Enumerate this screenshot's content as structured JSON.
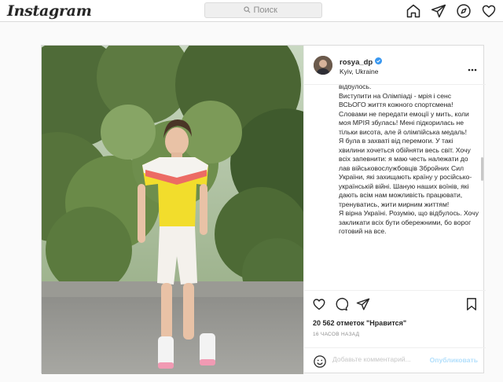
{
  "topbar": {
    "logo": "Instagram",
    "search_placeholder": "Поиск"
  },
  "post": {
    "username": "rosya_dp",
    "location": "Kyiv, Ukraine",
    "caption": "відбулось.\nВиступити на Олімпіаді - мрія і сенс ВСЬОГО життя кожного спортсмена! Словами не передати емоції у мить, коли моя МРІЯ збулась! Мені підкорилась не тільки висота, але й олімпійська медаль!\nЯ була в захваті від перемоги. У такі хвилини хочеться обійняти весь світ. Хочу всіх запевнити: я маю честь належати до лав військовослужбовців Збройних Сил України, які захищають країну у російсько-українській війні. Шаную наших воїнів, які дають всім нам можливість працювати, тренуватись, жити мирним життям!\nЯ вірна Україні. Розумію, що відбулось. Хочу закликати всіх бути обережними, бо ворог готовий на все.",
    "likes": "20 562 отметок \"Нравится\"",
    "time": "16 ЧАСОВ НАЗАД",
    "comment_placeholder": "Добавьте комментарий...",
    "post_button": "Опубликовать"
  },
  "icons": {
    "home": "home-icon",
    "direct": "direct-icon",
    "explore": "explore-icon",
    "activity": "heart-icon",
    "like": "heart-icon",
    "comment": "comment-icon",
    "share": "share-icon",
    "save": "bookmark-icon"
  },
  "colors": {
    "verified": "#3897f0",
    "post_button": "#b2dffc",
    "border": "#dbdbdb"
  }
}
